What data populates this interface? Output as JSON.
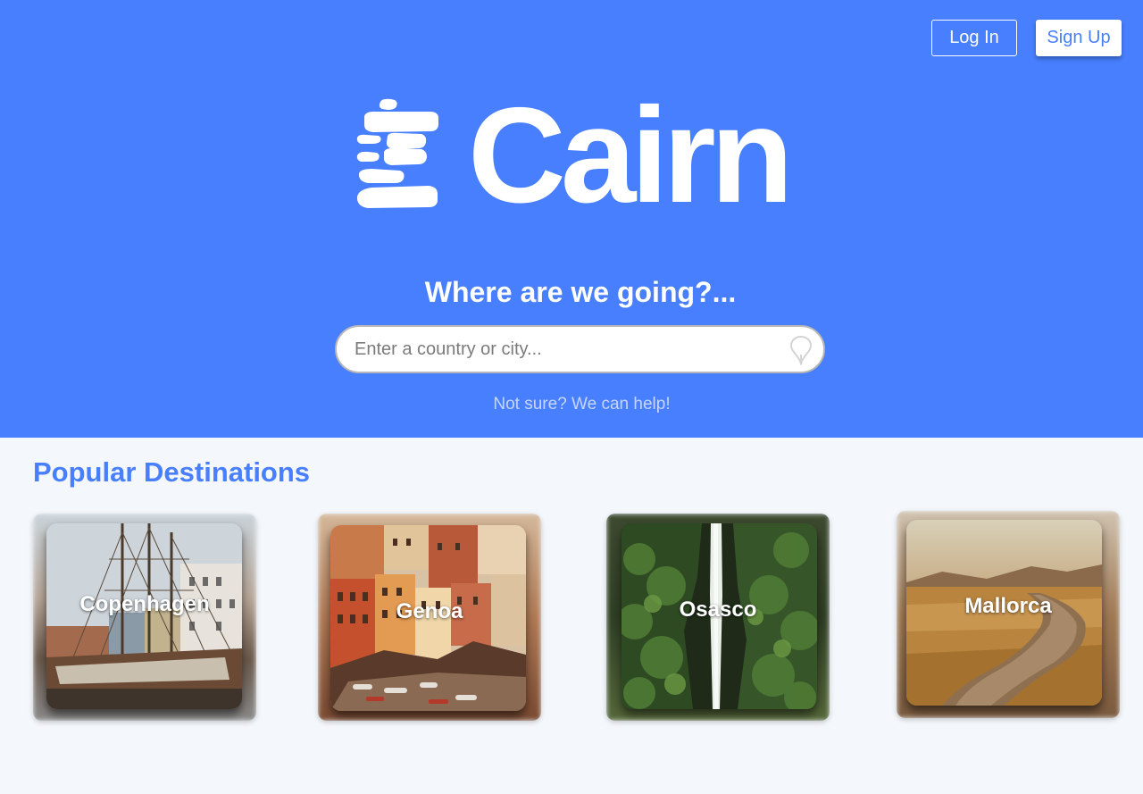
{
  "header": {
    "login_label": "Log In",
    "signup_label": "Sign Up"
  },
  "brand": {
    "name": "Cairn"
  },
  "hero": {
    "tagline": "Where are we going?...",
    "help_text": "Not sure? We can help!"
  },
  "search": {
    "placeholder": "Enter a country or city...",
    "value": ""
  },
  "destinations": {
    "title": "Popular Destinations",
    "items": [
      {
        "label": "Copenhagen",
        "image": "harbor-ships-photo"
      },
      {
        "label": "Genoa",
        "image": "colorful-coastal-village-photo"
      },
      {
        "label": "Osasco",
        "image": "jungle-waterfall-photo"
      },
      {
        "label": "Mallorca",
        "image": "dirt-road-fields-photo"
      }
    ]
  },
  "colors": {
    "accent": "#487ffe",
    "page_bg": "#f4f7fb",
    "help_text": "#c6d6ff"
  }
}
